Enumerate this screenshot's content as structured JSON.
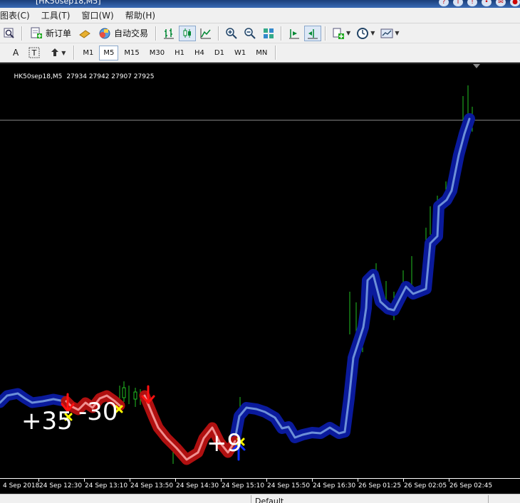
{
  "window": {
    "title": "[HK50sep18,M5]"
  },
  "menu": [
    "图表(C)",
    "工具(T)",
    "窗口(W)",
    "帮助(H)"
  ],
  "toolbar": {
    "new_order": "新订单",
    "auto_trading": "自动交易"
  },
  "timeframes": [
    "M1",
    "M5",
    "M15",
    "M30",
    "H1",
    "H4",
    "D1",
    "W1",
    "MN"
  ],
  "active_timeframe": "M5",
  "chart": {
    "symbol": "HK50sep18,M5",
    "ohlc": "27934 27942 27907 27925",
    "trade_labels": [
      "+35",
      "-30",
      "+9"
    ],
    "time_labels": [
      "4 Sep 2018",
      "24 Sep 12:30",
      "24 Sep 13:10",
      "24 Sep 13:50",
      "24 Sep 14:30",
      "24 Sep 15:10",
      "24 Sep 15:50",
      "24 Sep 16:30",
      "26 Sep 01:25",
      "26 Sep 02:05",
      "26 Sep 02:45"
    ],
    "colors": {
      "up_trend": "#0a1a9c",
      "up_inner": "#6c8fd8",
      "down_trend": "#b01010",
      "down_inner": "#f09090",
      "arrow_down": "#ff1010",
      "arrow_up": "#1030ff",
      "cross": "#ffff00",
      "candle": "#22c022"
    }
  },
  "status": {
    "profile": "Default"
  }
}
